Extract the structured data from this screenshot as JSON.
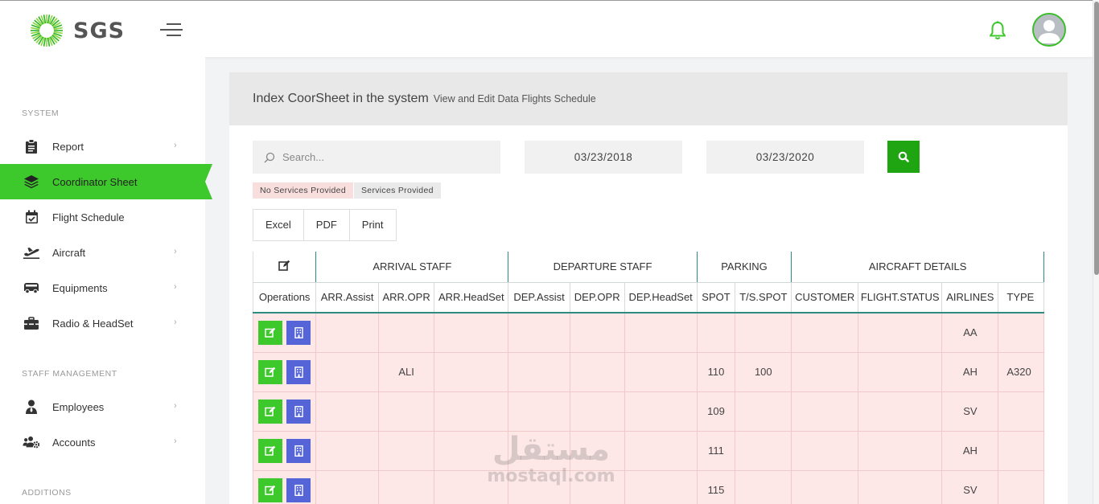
{
  "app": {
    "logo_text": "SGS",
    "brand_color": "#3dc82b",
    "accent_dark_green": "#1fa512",
    "secondary_button_color": "#5565d8"
  },
  "header": {
    "menu_icon": "hamburger-icon",
    "notification_icon": "bell-icon",
    "avatar_icon": "user-avatar"
  },
  "sidebar": {
    "sections": [
      {
        "heading": "SYSTEM",
        "items": [
          {
            "label": "Report",
            "icon": "clipboard-icon",
            "has_submenu": true,
            "active": false
          },
          {
            "label": "Coordinator Sheet",
            "icon": "layers-icon",
            "has_submenu": false,
            "active": true
          },
          {
            "label": "Flight Schedule",
            "icon": "calendar-check-icon",
            "has_submenu": false,
            "active": false
          },
          {
            "label": "Aircraft",
            "icon": "plane-departure-icon",
            "has_submenu": true,
            "active": false
          },
          {
            "label": "Equipments",
            "icon": "truck-icon",
            "has_submenu": true,
            "active": false
          },
          {
            "label": "Radio & HeadSet",
            "icon": "toolbox-icon",
            "has_submenu": true,
            "active": false
          }
        ]
      },
      {
        "heading": "STAFF MANAGEMENT",
        "items": [
          {
            "label": "Employees",
            "icon": "user-tie-icon",
            "has_submenu": true,
            "active": false
          },
          {
            "label": "Accounts",
            "icon": "users-cog-icon",
            "has_submenu": true,
            "active": false
          }
        ]
      },
      {
        "heading": "ADDITIONS",
        "items": []
      }
    ]
  },
  "panel": {
    "title": "Index CoorSheet in the system",
    "subtitle": "View and Edit Data Flights Schedule"
  },
  "filters": {
    "search_placeholder": "Search...",
    "search_value": "",
    "date_from": "03/23/2018",
    "date_to": "03/23/2020",
    "search_button_icon": "search-icon"
  },
  "legend": {
    "no_services": "No Services Provided",
    "services": "Services Provided",
    "no_services_color": "#f9dede",
    "services_color": "#eaeaea"
  },
  "exports": [
    "Excel",
    "PDF",
    "Print"
  ],
  "table": {
    "group_headers": [
      "ARRIVAL STAFF",
      "DEPARTURE STAFF",
      "PARKING",
      "AIRCRAFT DETAILS"
    ],
    "edit_header_icon": "edit-icon",
    "columns": [
      "Operations",
      "ARR.Assist",
      "ARR.OPR",
      "ARR.HeadSet",
      "DEP.Assist",
      "DEP.OPR",
      "DEP.HeadSet",
      "SPOT",
      "T/S.SPOT",
      "CUSTOMER",
      "FLIGHT.STATUS",
      "AIRLINES",
      "TYPE"
    ],
    "rows": [
      [
        "",
        "",
        "",
        "",
        "",
        "",
        "",
        "",
        "",
        "",
        "AA",
        ""
      ],
      [
        "",
        "ALI",
        "",
        "",
        "",
        "",
        "110",
        "100",
        "",
        "",
        "AH",
        "A320"
      ],
      [
        "",
        "",
        "",
        "",
        "",
        "",
        "109",
        "",
        "",
        "",
        "SV",
        ""
      ],
      [
        "",
        "",
        "",
        "",
        "",
        "",
        "111",
        "",
        "",
        "",
        "AH",
        ""
      ],
      [
        "",
        "",
        "",
        "",
        "",
        "",
        "115",
        "",
        "",
        "",
        "SV",
        ""
      ]
    ]
  },
  "watermark": {
    "arabic": "مستقل",
    "latin": "mostaql.com"
  }
}
